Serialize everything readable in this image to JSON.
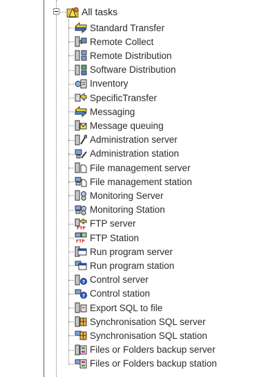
{
  "tree": {
    "root": {
      "label": "All tasks",
      "icon": "tasks-folder-icon"
    },
    "items": [
      {
        "label": "Standard Transfer",
        "icon": "transfer-arrows-icon"
      },
      {
        "label": "Remote Collect",
        "icon": "remote-collect-icon"
      },
      {
        "label": "Remote Distribution",
        "icon": "remote-distribution-icon"
      },
      {
        "label": "Software Distribution",
        "icon": "software-distribution-icon"
      },
      {
        "label": "Inventory",
        "icon": "inventory-icon"
      },
      {
        "label": "SpecificTransfer",
        "icon": "specific-transfer-icon"
      },
      {
        "label": "Messaging",
        "icon": "messaging-icon"
      },
      {
        "label": "Message queuing",
        "icon": "message-queue-icon"
      },
      {
        "label": "Administration server",
        "icon": "admin-server-icon"
      },
      {
        "label": "Administration station",
        "icon": "admin-station-icon"
      },
      {
        "label": "File management server",
        "icon": "file-server-icon"
      },
      {
        "label": "File management station",
        "icon": "file-station-icon"
      },
      {
        "label": "Monitoring Server",
        "icon": "monitoring-server-icon"
      },
      {
        "label": "Monitoring Station",
        "icon": "monitoring-station-icon"
      },
      {
        "label": "FTP server",
        "icon": "ftp-server-icon"
      },
      {
        "label": "FTP Station",
        "icon": "ftp-station-icon"
      },
      {
        "label": "Run program server",
        "icon": "run-server-icon"
      },
      {
        "label": "Run program station",
        "icon": "run-station-icon"
      },
      {
        "label": "Control server",
        "icon": "control-server-icon"
      },
      {
        "label": "Control station",
        "icon": "control-station-icon"
      },
      {
        "label": "Export SQL to file",
        "icon": "export-sql-icon"
      },
      {
        "label": "Synchronisation SQL server",
        "icon": "sync-sql-server-icon"
      },
      {
        "label": "Synchronisation SQL station",
        "icon": "sync-sql-station-icon"
      },
      {
        "label": "Files or Folders backup server",
        "icon": "backup-server-icon"
      },
      {
        "label": "Files or Folders backup station",
        "icon": "backup-station-icon"
      }
    ]
  }
}
